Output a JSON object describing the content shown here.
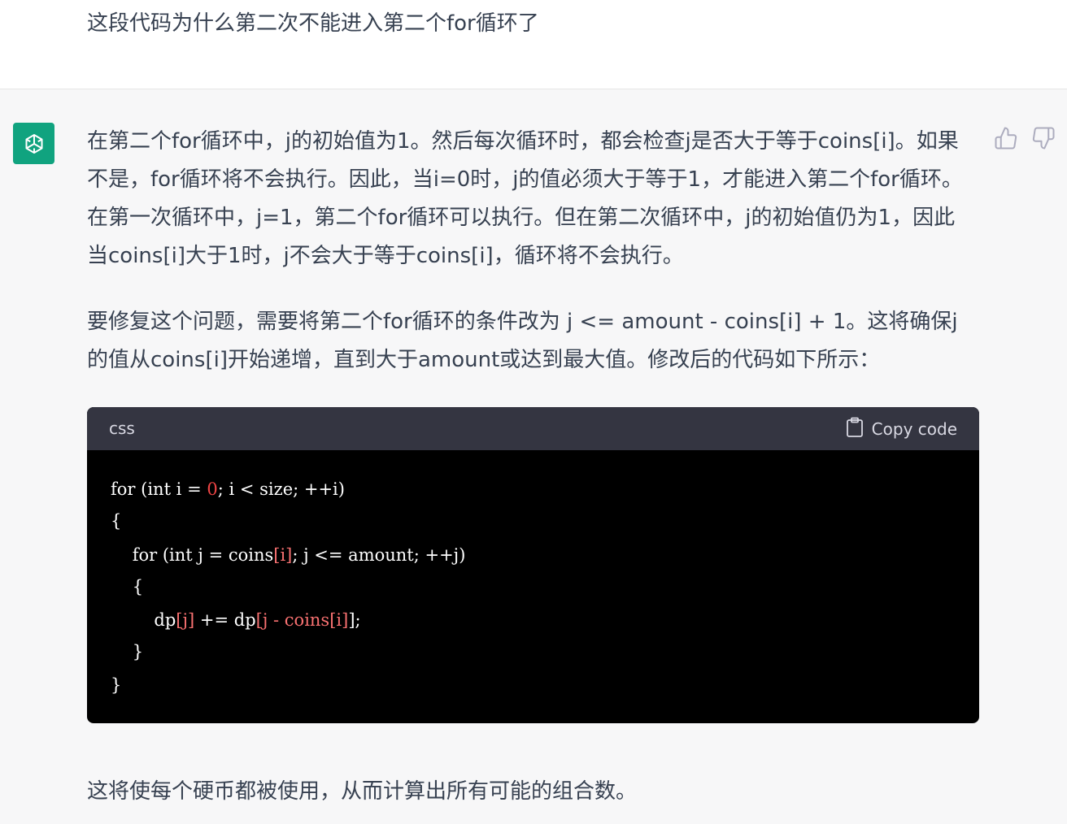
{
  "user_message": {
    "text": "这段代码为什么第二次不能进入第二个for循环了"
  },
  "assistant_message": {
    "avatar_icon": "openai-logo-icon",
    "accent_color": "#10a37f",
    "paragraph_1": "在第二个for循环中，j的初始值为1。然后每次循环时，都会检查j是否大于等于coins[i]。如果不是，for循环将不会执行。因此，当i=0时，j的值必须大于等于1，才能进入第二个for循环。在第一次循环中，j=1，第二个for循环可以执行。但在第二次循环中，j的初始值仍为1，因此当coins[i]大于1时，j不会大于等于coins[i]，循环将不会执行。",
    "paragraph_2": "要修复这个问题，需要将第二个for循环的条件改为 j <= amount - coins[i] + 1。这将确保j的值从coins[i]开始递增，直到大于amount或达到最大值。修改后的代码如下所示：",
    "paragraph_3": "这将使每个硬币都被使用，从而计算出所有可能的组合数。",
    "feedback": {
      "thumbs_up_icon": "thumbs-up-icon",
      "thumbs_down_icon": "thumbs-down-icon"
    }
  },
  "code_block": {
    "language": "css",
    "copy_label": "Copy code",
    "copy_icon": "clipboard-icon",
    "line_1": {
      "a": "for (int i = ",
      "num": "0",
      "b": "; i < size; ++i)"
    },
    "line_2": "{",
    "line_3": {
      "a": "    for (int j = coins",
      "br": "[i]",
      "b": "; j <= amount; ++j)"
    },
    "line_4": "    {",
    "line_5": {
      "a": "        dp",
      "br1": "[j]",
      "b": " += dp",
      "br2": "[j - coins[i]",
      "c": "];"
    },
    "line_6": "    }",
    "line_7": "}"
  }
}
